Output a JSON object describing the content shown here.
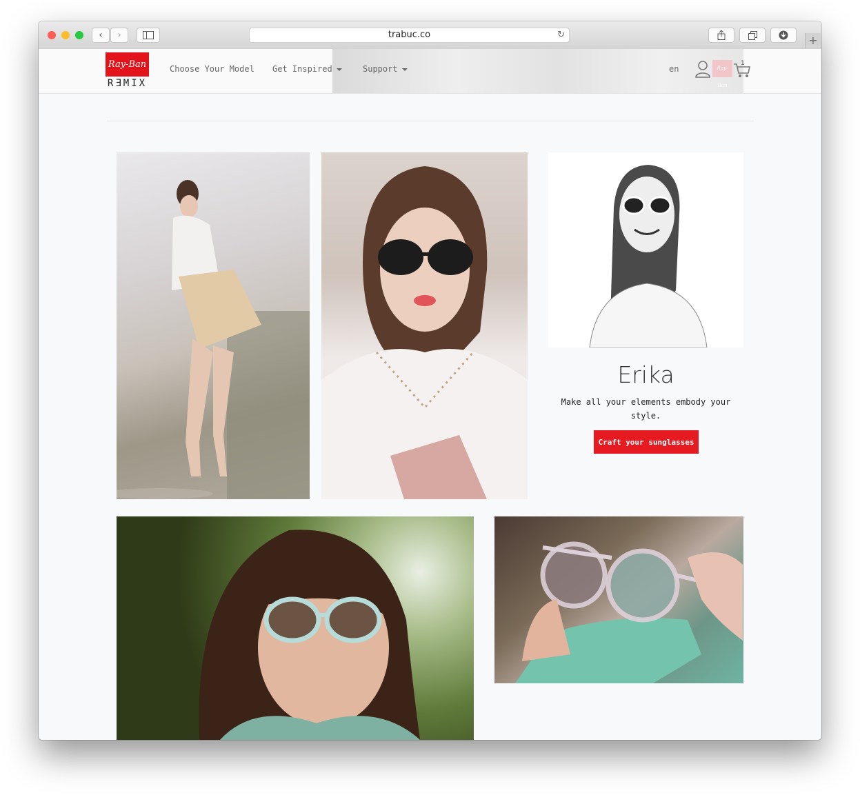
{
  "browser": {
    "url": "trabuc.co",
    "traffic_lights": [
      "#fc5f57",
      "#fdbc2e",
      "#28c840"
    ]
  },
  "header": {
    "logo_script": "Ray-Ban",
    "logo_wordmark": "RƎMIX",
    "nav": [
      {
        "label": "Choose Your Model",
        "has_dropdown": false
      },
      {
        "label": "Get Inspired",
        "has_dropdown": true
      },
      {
        "label": "Support",
        "has_dropdown": true
      }
    ],
    "language": "en",
    "cart_count": "1"
  },
  "feature": {
    "title": "Erika",
    "description": "Make all your elements embody your style.",
    "cta_label": "Craft your sunglasses",
    "accent_color": "#e61b22"
  },
  "gallery": [
    {
      "name": "woman-sitting-on-wall-photo"
    },
    {
      "name": "woman-studded-collar-portrait-photo"
    },
    {
      "name": "model-white-sunglasses-portrait-photo"
    },
    {
      "name": "woman-mint-sunglasses-closeup-photo"
    },
    {
      "name": "hands-holding-sunglasses-photo"
    }
  ]
}
